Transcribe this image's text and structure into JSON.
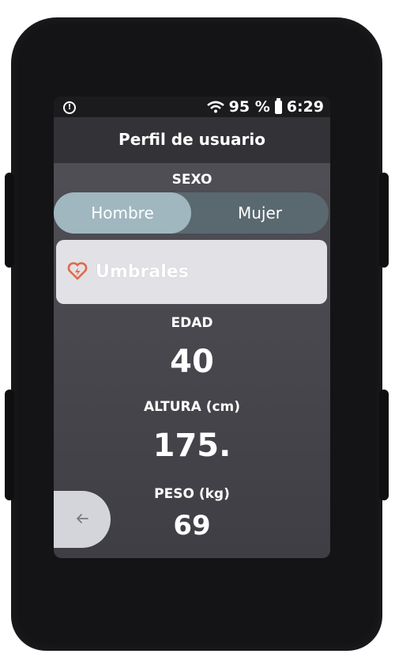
{
  "status": {
    "battery_percent": "95 %",
    "time": "6:29"
  },
  "header": {
    "title": "Perfil de usuario"
  },
  "gender": {
    "label": "SEXO",
    "options": [
      "Hombre",
      "Mujer"
    ],
    "selected": "Hombre"
  },
  "thresholds": {
    "label": "Umbrales",
    "icon": "heart-lightning-icon",
    "icon_color": "#e06a47"
  },
  "age": {
    "label": "EDAD",
    "value": "40"
  },
  "height": {
    "label": "ALTURA (cm)",
    "value": "175."
  },
  "weight": {
    "label": "PESO (kg)",
    "value": "69"
  },
  "nav": {
    "back_icon": "arrow-left-icon"
  }
}
